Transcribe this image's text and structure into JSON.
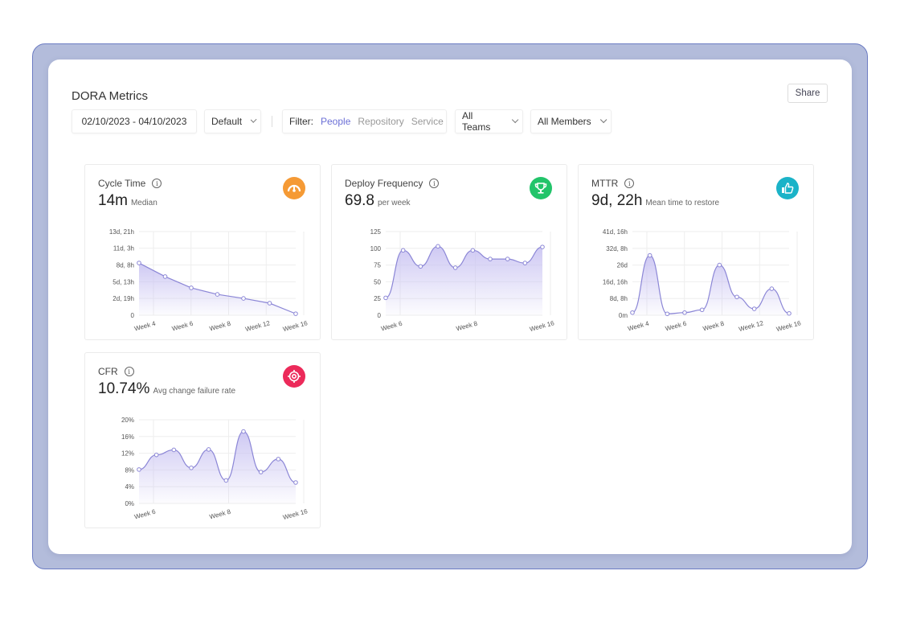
{
  "page": {
    "title": "DORA Metrics",
    "share_label": "Share"
  },
  "toolbar": {
    "date_range": "02/10/2023 - 04/10/2023",
    "preset": "Default",
    "filter_label": "Filter:",
    "filter_options": [
      {
        "label": "People",
        "active": true
      },
      {
        "label": "Repository",
        "active": false
      },
      {
        "label": "Service",
        "active": false
      }
    ],
    "teams": "All Teams",
    "members": "All Members"
  },
  "colors": {
    "accent": "#6b6fd6",
    "line": "#8b86d6",
    "fill": "#c9c3f2",
    "frame": "#b3bcdb"
  },
  "cards": [
    {
      "title": "Cycle Time",
      "value": "14m",
      "sub": "Median",
      "icon": "gauge-icon",
      "icon_color": "#f59a35"
    },
    {
      "title": "Deploy Frequency",
      "value": "69.8",
      "sub": "per week",
      "icon": "trophy-icon",
      "icon_color": "#22c46a"
    },
    {
      "title": "MTTR",
      "value": "9d, 22h",
      "sub": "Mean time to restore",
      "icon": "thumbs-up-icon",
      "icon_color": "#1bb3c8"
    },
    {
      "title": "CFR",
      "value": "10.74%",
      "sub": "Avg change failure rate",
      "icon": "target-icon",
      "icon_color": "#ec2a5a"
    }
  ],
  "chart_data": [
    {
      "type": "area",
      "y_unit": "hours",
      "ylim": [
        0,
        333
      ],
      "yticks": [
        0,
        67,
        133,
        200,
        267,
        333
      ],
      "ytick_labels": [
        "0",
        "2d, 19h",
        "5d, 13h",
        "8d, 8h",
        "11d, 3h",
        "13d, 21h"
      ],
      "xtick_labels": [
        "Week 4",
        "Week 6",
        "Week 8",
        "Week 12",
        "Week 16"
      ],
      "values": [
        208,
        154,
        109,
        83,
        67,
        48,
        6
      ],
      "grid": true
    },
    {
      "type": "area",
      "ylim": [
        0,
        125
      ],
      "yticks": [
        0,
        25,
        50,
        75,
        100,
        125
      ],
      "ytick_labels": [
        "0",
        "25",
        "50",
        "75",
        "100",
        "125"
      ],
      "xtick_labels": [
        "Week 6",
        "Week 8",
        "Week 16"
      ],
      "values": [
        26,
        97,
        73,
        103,
        71,
        97,
        84,
        84,
        78,
        102
      ],
      "grid": true
    },
    {
      "type": "area",
      "y_unit": "days",
      "ylim": [
        0,
        41.67
      ],
      "yticks": [
        0,
        8.33,
        16.67,
        25,
        33.33,
        41.67
      ],
      "ytick_labels": [
        "0m",
        "8d, 8h",
        "16d, 16h",
        "26d",
        "32d, 8h",
        "41d, 16h"
      ],
      "xtick_labels": [
        "Week 4",
        "Week 6",
        "Week 8",
        "Week 12",
        "Week 16"
      ],
      "values": [
        1.3,
        29.8,
        0.7,
        1.3,
        2.7,
        25,
        9.1,
        3.2,
        13.2,
        0.9
      ],
      "grid": true
    },
    {
      "type": "area",
      "y_unit": "percent",
      "ylim": [
        0,
        20
      ],
      "yticks": [
        0,
        4,
        8,
        12,
        16,
        20
      ],
      "ytick_labels": [
        "0%",
        "4%",
        "8%",
        "12%",
        "16%",
        "20%"
      ],
      "xtick_labels": [
        "Week 6",
        "Week 8",
        "Week 16"
      ],
      "values": [
        8.1,
        11.6,
        12.8,
        8.5,
        12.9,
        5.5,
        17.2,
        7.5,
        10.6,
        5.0
      ],
      "grid": true
    }
  ]
}
